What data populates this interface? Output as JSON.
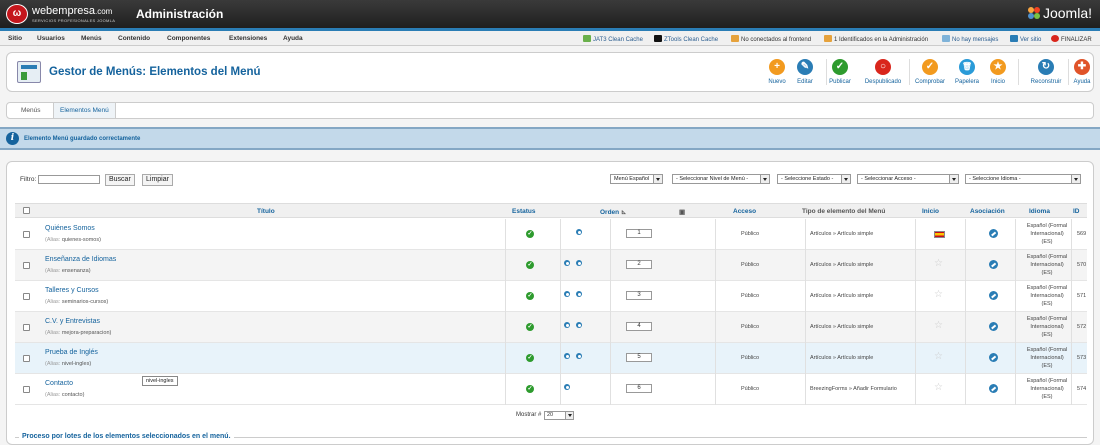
{
  "header": {
    "brand": "webempresa",
    "brand_suffix": ".com",
    "brand_tagline": "SERVICIOS PROFESIONALES JOOMLA",
    "title": "Administración",
    "joomla_logo": "Joomla!"
  },
  "menu": [
    "Sitio",
    "Usuarios",
    "Menús",
    "Contenido",
    "Componentes",
    "Extensiones",
    "Ayuda"
  ],
  "status": {
    "jat3": "JAT3 Clean Cache",
    "ztools": "ZTools Clean Cache",
    "frontend": "No conectados al frontend",
    "admin": "1 Identificados en la Administración",
    "messages": "No hay mensajes",
    "view_site": "Ver sitio",
    "logout": "FINALIZAR"
  },
  "toolbar": {
    "page_title": "Gestor de Menús: Elementos del Menú",
    "buttons": [
      {
        "label": "Nuevo",
        "color": "#f29a1f",
        "glyph": "+"
      },
      {
        "label": "Editar",
        "color": "#2a7db5",
        "glyph": "✎"
      },
      {
        "label": "Publicar",
        "color": "#2e9b2e",
        "glyph": "✓"
      },
      {
        "label": "Despublicado",
        "color": "#d9261c",
        "glyph": "○"
      },
      {
        "label": "Comprobar",
        "color": "#f29a1f",
        "glyph": "✓"
      },
      {
        "label": "Papelera",
        "color": "#2a9bd8",
        "glyph": "🗑"
      },
      {
        "label": "Inicio",
        "color": "#f29a1f",
        "glyph": "★"
      },
      {
        "label": "Reconstruir",
        "color": "#2a7db5",
        "glyph": "↻"
      },
      {
        "label": "Ayuda",
        "color": "#e0542a",
        "glyph": "✚"
      }
    ]
  },
  "subtabs": [
    "Menús",
    "Elementos Menú"
  ],
  "message": "Elemento Menú guardado correctamente",
  "filters": {
    "label": "Filtro:",
    "value": "",
    "search_button": "Buscar",
    "clear_button": "Limpiar",
    "selects": [
      "Menú Español",
      "- Seleccionar Nivel de Menú -",
      "- Seleccione Estado -",
      "- Seleccionar Acceso -",
      "- Seleccione Idioma -"
    ]
  },
  "table": {
    "headers": {
      "title": "Título",
      "status": "Estatus",
      "order": "Orden",
      "access": "Acceso",
      "type": "Tipo de elemento del Menú",
      "home": "Inicio",
      "association": "Asociación",
      "language": "Idioma",
      "id": "ID"
    },
    "alias_label": "(Alias:",
    "rows": [
      {
        "title": "Quiénes Somos",
        "alias": "quienes-somos)",
        "order": "1",
        "arrows": 1,
        "access": "Público",
        "type": "Artículos » Artículo simple",
        "home": "flag",
        "language": [
          "Español (Formal",
          "Internacional)",
          "(ES)"
        ],
        "id": "569"
      },
      {
        "title": "Enseñanza de Idiomas",
        "alias": "ensenanza)",
        "order": "2",
        "arrows": 2,
        "access": "Público",
        "type": "Artículos » Artículo simple",
        "home": "star",
        "language": [
          "Español (Formal",
          "Internacional)",
          "(ES)"
        ],
        "id": "570"
      },
      {
        "title": "Talleres y Cursos",
        "alias": "seminarios-cursos)",
        "order": "3",
        "arrows": 2,
        "access": "Público",
        "type": "Artículos » Artículo simple",
        "home": "star",
        "language": [
          "Español (Formal",
          "Internacional)",
          "(ES)"
        ],
        "id": "571"
      },
      {
        "title": "C.V. y Entrevistas",
        "alias": "mejora-preparacion)",
        "order": "4",
        "arrows": 2,
        "access": "Público",
        "type": "Artículos » Artículo simple",
        "home": "star",
        "language": [
          "Español (Formal",
          "Internacional)",
          "(ES)"
        ],
        "id": "572"
      },
      {
        "title": "Prueba de Inglés",
        "alias": "nivel-ingles)",
        "order": "5",
        "arrows": 2,
        "access": "Público",
        "type": "Artículos » Artículo simple",
        "home": "star",
        "language": [
          "Español (Formal",
          "Internacional)",
          "(ES)"
        ],
        "id": "573"
      },
      {
        "title": "Contacto",
        "alias": "contacto)",
        "order": "6",
        "arrows": 1,
        "access": "Público",
        "type": "BreezingForms » Añadir Formulario",
        "home": "star",
        "language": [
          "Español (Formal",
          "Internacional)",
          "(ES)"
        ],
        "id": "574"
      }
    ]
  },
  "tooltip": "nivel-ingles",
  "footer": {
    "show_label": "Mostrar #",
    "show_value": "20"
  },
  "batch_title": "Proceso por lotes de los elementos seleccionados en el menú."
}
